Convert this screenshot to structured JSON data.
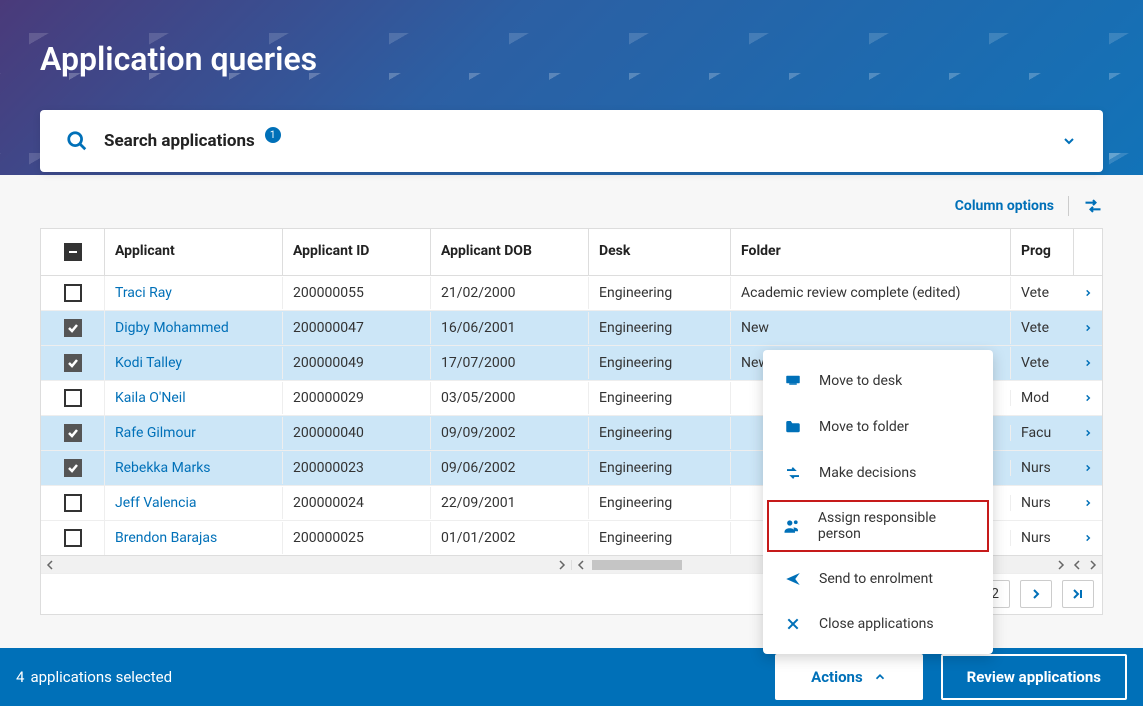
{
  "page_title": "Application queries",
  "search": {
    "label": "Search applications",
    "badge": "1"
  },
  "toolbar": {
    "column_options": "Column options"
  },
  "columns": {
    "applicant": "Applicant",
    "applicant_id": "Applicant ID",
    "applicant_dob": "Applicant DOB",
    "desk": "Desk",
    "folder": "Folder",
    "program": "Prog"
  },
  "rows": [
    {
      "selected": false,
      "name": "Traci Ray",
      "id": "200000055",
      "dob": "21/02/2000",
      "desk": "Engineering",
      "folder": "Academic review complete (edited)",
      "prog": "Vete"
    },
    {
      "selected": true,
      "name": "Digby Mohammed",
      "id": "200000047",
      "dob": "16/06/2001",
      "desk": "Engineering",
      "folder": "New",
      "prog": "Vete"
    },
    {
      "selected": true,
      "name": "Kodi Talley",
      "id": "200000049",
      "dob": "17/07/2000",
      "desk": "Engineering",
      "folder": "New",
      "prog": "Vete"
    },
    {
      "selected": false,
      "name": "Kaila O'Neil",
      "id": "200000029",
      "dob": "03/05/2000",
      "desk": "Engineering",
      "folder": "",
      "prog": "Mod"
    },
    {
      "selected": true,
      "name": "Rafe Gilmour",
      "id": "200000040",
      "dob": "09/09/2002",
      "desk": "Engineering",
      "folder": "",
      "prog": "Facu"
    },
    {
      "selected": true,
      "name": "Rebekka Marks",
      "id": "200000023",
      "dob": "09/06/2002",
      "desk": "Engineering",
      "folder": "",
      "prog": "Nurs"
    },
    {
      "selected": false,
      "name": "Jeff Valencia",
      "id": "200000024",
      "dob": "22/09/2001",
      "desk": "Engineering",
      "folder": "",
      "prog": "Nurs"
    },
    {
      "selected": false,
      "name": "Brendon Barajas",
      "id": "200000025",
      "dob": "01/01/2002",
      "desk": "Engineering",
      "folder": "",
      "prog": "Nurs"
    }
  ],
  "pagination": {
    "total": "12"
  },
  "status_bar": {
    "count": "4",
    "label": "applications selected",
    "actions_label": "Actions",
    "review_label": "Review applications"
  },
  "actions_menu": {
    "move_desk": "Move to desk",
    "move_folder": "Move to folder",
    "make_decisions": "Make decisions",
    "assign_person": "Assign responsible person",
    "send_enrolment": "Send to enrolment",
    "close_apps": "Close applications"
  }
}
